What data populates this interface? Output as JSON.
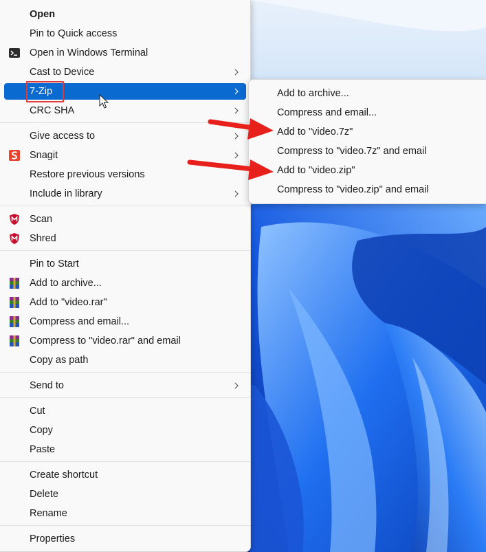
{
  "context_menu": {
    "items": [
      {
        "label": "Open",
        "bold": true
      },
      {
        "label": "Pin to Quick access"
      },
      {
        "label": "Open in Windows Terminal",
        "icon": "terminal-icon"
      },
      {
        "label": "Cast to Device",
        "submenu": true
      },
      {
        "label": "7-Zip",
        "submenu": true,
        "highlighted": true
      },
      {
        "label": "CRC SHA",
        "submenu": true
      },
      {
        "label": "Give access to",
        "submenu": true
      },
      {
        "label": "Snagit",
        "submenu": true,
        "icon": "snagit-icon"
      },
      {
        "label": "Restore previous versions"
      },
      {
        "label": "Include in library",
        "submenu": true
      },
      {
        "label": "Scan",
        "icon": "mcafee-icon"
      },
      {
        "label": "Shred",
        "icon": "mcafee-icon"
      },
      {
        "label": "Pin to Start"
      },
      {
        "label": "Add to archive...",
        "icon": "winrar-icon"
      },
      {
        "label": "Add to \"video.rar\"",
        "icon": "winrar-icon"
      },
      {
        "label": "Compress and email...",
        "icon": "winrar-icon"
      },
      {
        "label": "Compress to \"video.rar\" and email",
        "icon": "winrar-icon"
      },
      {
        "label": "Copy as path"
      },
      {
        "label": "Send to",
        "submenu": true
      },
      {
        "label": "Cut"
      },
      {
        "label": "Copy"
      },
      {
        "label": "Paste"
      },
      {
        "label": "Create shortcut"
      },
      {
        "label": "Delete"
      },
      {
        "label": "Rename"
      },
      {
        "label": "Properties"
      }
    ]
  },
  "submenu_7zip": {
    "items": [
      {
        "label": "Add to archive..."
      },
      {
        "label": "Compress and email..."
      },
      {
        "label": "Add to \"video.7z\"",
        "annotated": true
      },
      {
        "label": "Compress to \"video.7z\" and email"
      },
      {
        "label": "Add to \"video.zip\"",
        "annotated": true
      },
      {
        "label": "Compress to \"video.zip\" and email"
      }
    ]
  },
  "colors": {
    "highlight": "#0a6ad0",
    "annotation_red": "#e03a3a",
    "menu_bg": "#f9f9f9",
    "wallpaper_blue": "#1f5fe0"
  }
}
